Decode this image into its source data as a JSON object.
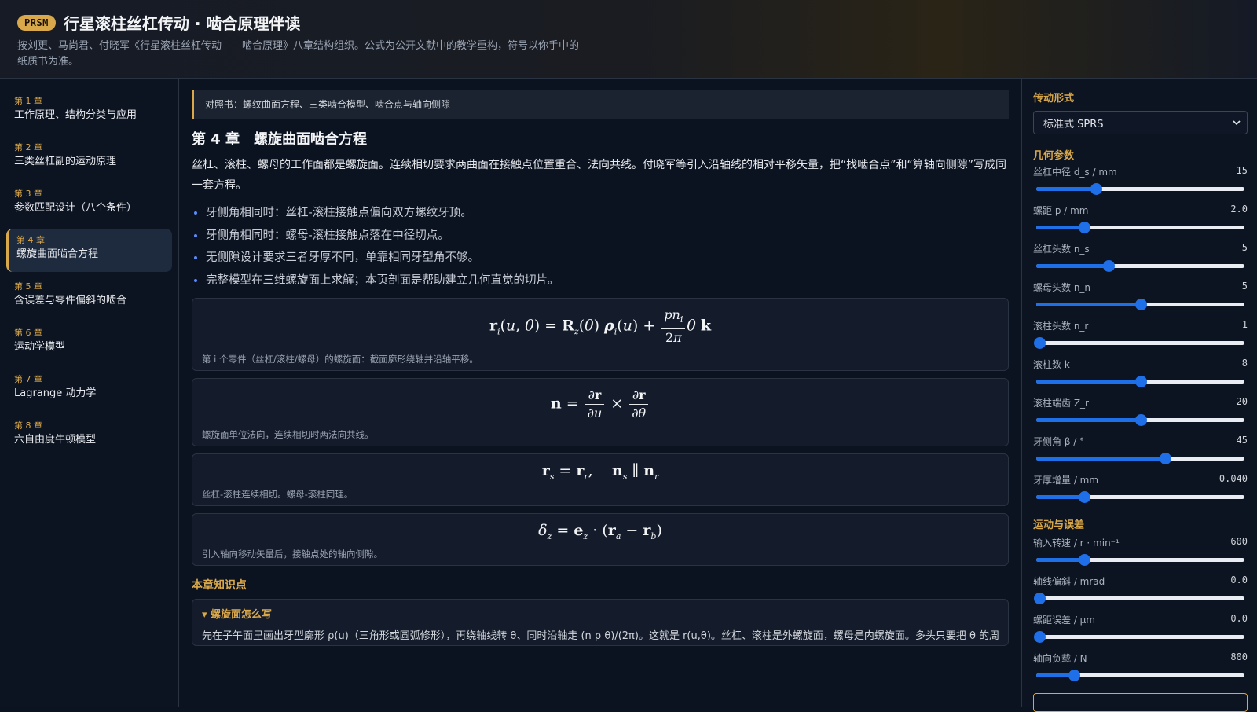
{
  "header": {
    "badge": "PRSM",
    "title": "行星滚柱丝杠传动 · 啮合原理伴读",
    "subtitle": "按刘更、马尚君、付晓军《行星滚柱丝杠传动——啮合原理》八章结构组织。公式为公开文献中的教学重构，符号以你手中的纸质书为准。"
  },
  "sidebar": {
    "chapters": [
      {
        "num": "第 1 章",
        "name": "工作原理、结构分类与应用"
      },
      {
        "num": "第 2 章",
        "name": "三类丝杠副的运动原理"
      },
      {
        "num": "第 3 章",
        "name": "参数匹配设计（八个条件）"
      },
      {
        "num": "第 4 章",
        "name": "螺旋曲面啮合方程"
      },
      {
        "num": "第 5 章",
        "name": "含误差与零件偏斜的啮合"
      },
      {
        "num": "第 6 章",
        "name": "运动学模型"
      },
      {
        "num": "第 7 章",
        "name": "Lagrange 动力学"
      },
      {
        "num": "第 8 章",
        "name": "六自由度牛顿模型"
      }
    ]
  },
  "main": {
    "ref": "对照书：螺纹曲面方程、三类啮合模型、啮合点与轴向侧隙",
    "chapter_title": "第 4 章　螺旋曲面啮合方程",
    "intro": "丝杠、滚柱、螺母的工作面都是螺旋面。连续相切要求两曲面在接触点位置重合、法向共线。付晓军等引入沿轴线的相对平移矢量，把“找啮合点”和“算轴向侧隙”写成同一套方程。",
    "bullets": [
      "牙侧角相同时：丝杠-滚柱接触点偏向双方螺纹牙顶。",
      "牙侧角相同时：螺母-滚柱接触点落在中径切点。",
      "无侧隙设计要求三者牙厚不同，单靠相同牙型角不够。",
      "完整模型在三维螺旋面上求解；本页剖面是帮助建立几何直觉的切片。"
    ],
    "formulas": [
      {
        "caption": "第 i 个零件（丝杠/滚柱/螺母）的螺旋面：截面廓形绕轴并沿轴平移。"
      },
      {
        "caption": "螺旋面单位法向，连续相切时两法向共线。"
      },
      {
        "caption": "丝杠-滚柱连续相切。螺母-滚柱同理。"
      },
      {
        "caption": "引入轴向移动矢量后，接触点处的轴向侧隙。"
      }
    ],
    "section_title": "本章知识点",
    "details": {
      "summary": "▾ 螺旋面怎么写",
      "body": "先在子午面里画出牙型廓形 ρ(u)（三角形或圆弧修形），再绕轴线转 θ、同时沿轴走 (n p θ)/(2π)。这就是 r(u,θ)。丝杠、滚柱是外螺旋面，螺母是内螺旋面。多头只要把 θ 的周期"
    }
  },
  "panel": {
    "drive_title": "传动形式",
    "drive_value": "标准式 SPRS",
    "geometry_title": "几何参数",
    "geometry": [
      {
        "label": "丝杠中径 d_s / mm",
        "value": "15",
        "fraction": 0.28
      },
      {
        "label": "螺距 p / mm",
        "value": "2.0",
        "fraction": 0.22
      },
      {
        "label": "丝杠头数 n_s",
        "value": "5",
        "fraction": 0.34
      },
      {
        "label": "螺母头数 n_n",
        "value": "5",
        "fraction": 0.5
      },
      {
        "label": "滚柱头数 n_r",
        "value": "1",
        "fraction": 0.0
      },
      {
        "label": "滚柱数 k",
        "value": "8",
        "fraction": 0.5
      },
      {
        "label": "滚柱端齿 Z_r",
        "value": "20",
        "fraction": 0.5
      },
      {
        "label": "牙侧角 β / °",
        "value": "45",
        "fraction": 0.62
      },
      {
        "label": "牙厚增量 / mm",
        "value": "0.040",
        "fraction": 0.22
      }
    ],
    "motion_title": "运动与误差",
    "motion": [
      {
        "label": "输入转速 / r · min⁻¹",
        "value": "600",
        "fraction": 0.22
      },
      {
        "label": "轴线偏斜 / mrad",
        "value": "0.0",
        "fraction": 0.0
      },
      {
        "label": "螺距误差 / μm",
        "value": "0.0",
        "fraction": 0.0
      },
      {
        "label": "轴向负载 / N",
        "value": "800",
        "fraction": 0.17
      }
    ]
  }
}
